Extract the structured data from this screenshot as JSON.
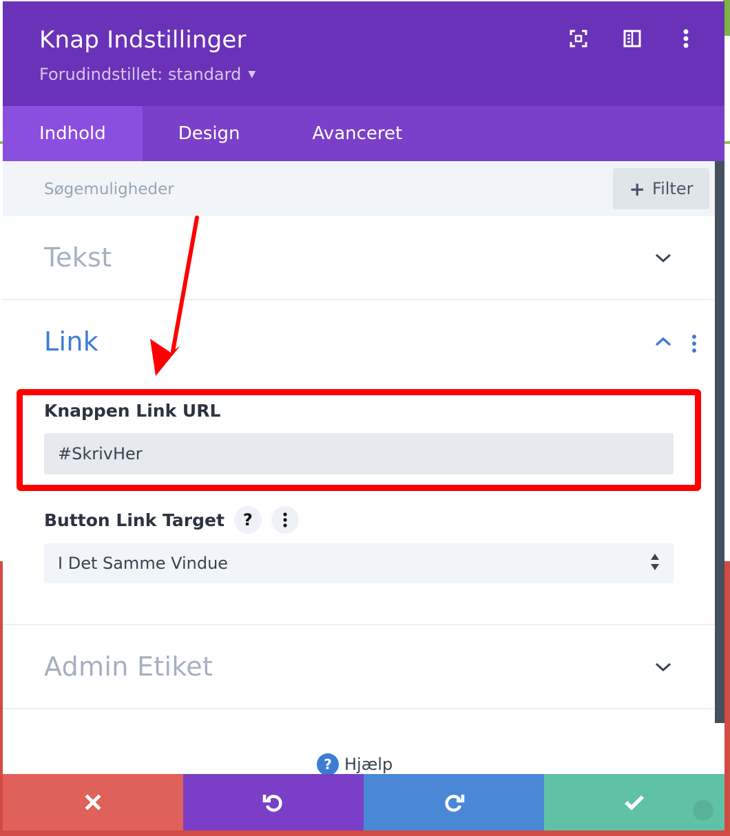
{
  "modal": {
    "title": "Knap Indstillinger",
    "preset": "Forudindstillet: standard"
  },
  "tabs": [
    {
      "label": "Indhold",
      "active": true
    },
    {
      "label": "Design",
      "active": false
    },
    {
      "label": "Avanceret",
      "active": false
    }
  ],
  "search": {
    "placeholder": "Søgemuligheder",
    "filter_label": "Filter"
  },
  "sections": {
    "tekst": "Tekst",
    "link": "Link",
    "admin": "Admin Etiket"
  },
  "link": {
    "url_label": "Knappen Link URL",
    "url_value": "#SkrivHer",
    "target_label": "Button Link Target",
    "target_value": "I Det Samme Vindue"
  },
  "help": {
    "label": "Hjælp"
  },
  "icons": {
    "header": [
      "focus-icon",
      "split-view-icon",
      "more-vertical-icon"
    ],
    "footer": [
      "close-icon",
      "undo-icon",
      "redo-icon",
      "check-icon"
    ]
  },
  "colors": {
    "header": "#6a32b8",
    "tabs": "#7b40c9",
    "active_tab": "#8b4fe0",
    "link_accent": "#3c7cd5",
    "highlight": "#ff0000",
    "cancel": "#e0605a",
    "undo": "#7a3fc6",
    "redo": "#4a87d6",
    "save": "#5fc2a6"
  }
}
